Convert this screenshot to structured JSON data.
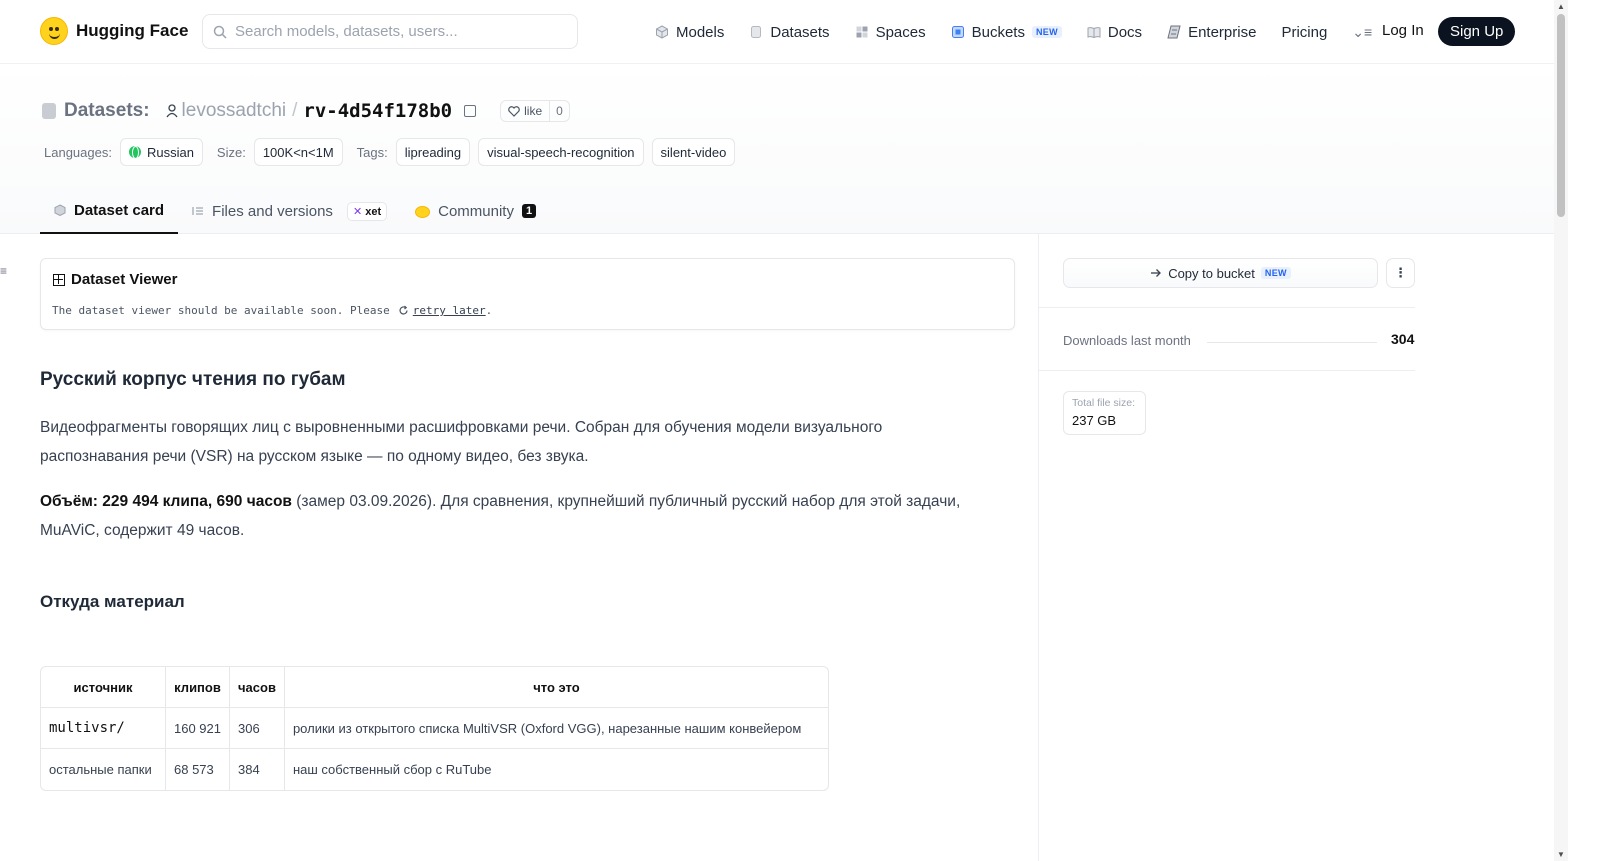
{
  "nav": {
    "brand": "Hugging Face",
    "search_placeholder": "Search models, datasets, users...",
    "links": [
      "Models",
      "Datasets",
      "Spaces",
      "Buckets",
      "Docs",
      "Enterprise",
      "Pricing"
    ],
    "buckets_badge": "NEW",
    "login": "Log In",
    "signup": "Sign Up"
  },
  "repo": {
    "section": "Datasets:",
    "user": "levossadtchi",
    "slash": "/",
    "name": "rv-4d54f178b0",
    "like_label": "like",
    "like_count": "0"
  },
  "meta": {
    "languages_label": "Languages:",
    "language": "Russian",
    "size_label": "Size:",
    "size": "100K<n<1M",
    "tags_label": "Tags:",
    "tags": [
      "lipreading",
      "visual-speech-recognition",
      "silent-video"
    ]
  },
  "tabs": {
    "card": "Dataset card",
    "files": "Files and versions",
    "xet": "xet",
    "community": "Community",
    "community_count": "1"
  },
  "viewer": {
    "title": "Dataset Viewer",
    "message": "The dataset viewer should be available soon. Please",
    "retry": "retry later",
    "period": "."
  },
  "card": {
    "heading": "Русский корпус чтения по губам",
    "para1": "Видеофрагменты говорящих лиц с выровненными расшифровками речи. Собран для обучения модели визуального распознавания речи (VSR) на русском языке — по одному видео, без звука.",
    "para2_bold": "Объём: 229 494 клипа, 690 часов",
    "para2_rest": " (замер 03.09.2026). Для сравнения, крупнейший публичный русский набор для этой задачи, MuAViC, содержит 49 часов.",
    "subheading": "Откуда материал"
  },
  "table": {
    "headers": [
      "источник",
      "клипов",
      "часов",
      "что это"
    ],
    "rows": [
      [
        "multivsr/",
        "160 921",
        "306",
        "ролики из открытого списка MultiVSR (Oxford VGG), нарезанные нашим конвейером"
      ],
      [
        "остальные папки",
        "68 573",
        "384",
        "наш собственный сбор с RuTube"
      ]
    ]
  },
  "sidebar": {
    "copy_bucket": "Copy to bucket",
    "copy_badge": "NEW",
    "downloads_label": "Downloads last month",
    "downloads_value": "304",
    "file_size_label": "Total file size:",
    "file_size_value": "237 GB"
  },
  "colors": {
    "accent_new": "#2563eb",
    "signup_bg": "#0b1220",
    "logo_yellow": "#ffd21e"
  },
  "icons": [
    "search-icon",
    "models-icon",
    "datasets-icon",
    "spaces-icon",
    "buckets-icon",
    "docs-icon",
    "enterprise-icon",
    "menu-icon",
    "database-icon",
    "user-icon",
    "copy-icon",
    "heart-icon",
    "globe-icon",
    "grid-icon",
    "refresh-icon",
    "arrow-right-icon",
    "kebab-icon"
  ]
}
